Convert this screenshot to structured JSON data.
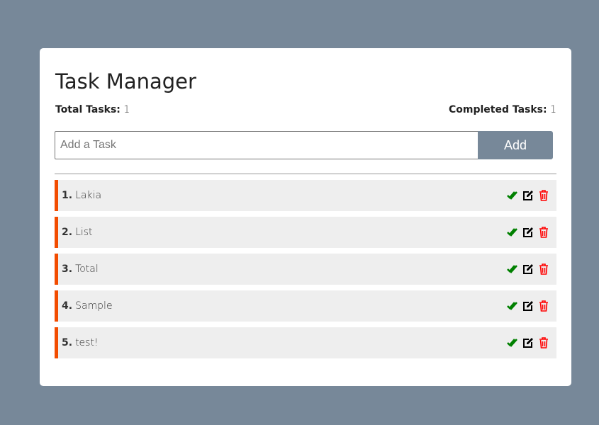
{
  "title": "Task Manager",
  "stats": {
    "total_label": "Total Tasks:",
    "total": "1",
    "completed_label": "Completed Tasks:",
    "completed": "1"
  },
  "input": {
    "placeholder": "Add a Task",
    "value": ""
  },
  "add_label": "Add",
  "tasks": [
    {
      "num": "1.",
      "text": "Lakia"
    },
    {
      "num": "2.",
      "text": "List"
    },
    {
      "num": "3.",
      "text": "Total"
    },
    {
      "num": "4.",
      "text": "Sample"
    },
    {
      "num": "5.",
      "text": "test!"
    }
  ],
  "colors": {
    "accent": "#f24c00",
    "complete": "#008000",
    "delete": "#ff0000",
    "button": "#778899"
  }
}
